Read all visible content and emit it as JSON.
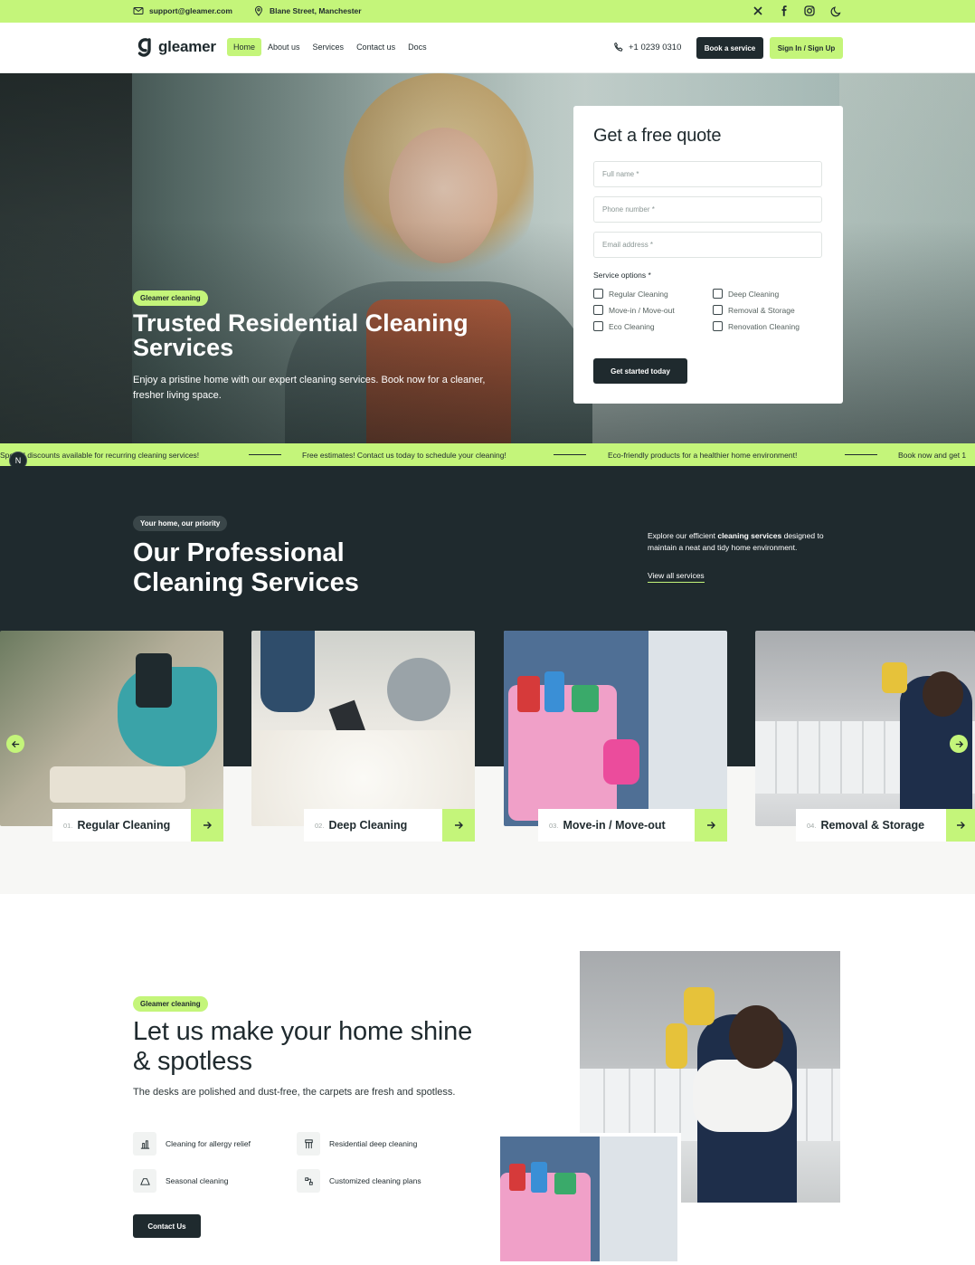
{
  "topbar": {
    "email": "support@gleamer.com",
    "address": "Blane Street, Manchester"
  },
  "nav": {
    "brand": "gleamer",
    "links": [
      "Home",
      "About us",
      "Services",
      "Contact us",
      "Docs"
    ],
    "active": "Home",
    "phone": "+1 0239 0310",
    "book_label": "Book a service",
    "signin_label": "Sign In / Sign Up"
  },
  "hero": {
    "tag": "Gleamer cleaning",
    "title": "Trusted Residential Cleaning Services",
    "subtitle": "Enjoy a pristine home with our expert cleaning services. Book now for a cleaner, fresher living space."
  },
  "quote": {
    "title": "Get a free quote",
    "name_placeholder": "Full name *",
    "phone_placeholder": "Phone number *",
    "email_placeholder": "Email address *",
    "options_label": "Service options *",
    "options": [
      "Regular Cleaning",
      "Deep Cleaning",
      "Move-in / Move-out",
      "Removal & Storage",
      "Eco Cleaning",
      "Renovation Cleaning"
    ],
    "submit_label": "Get started today"
  },
  "ticker": {
    "items": [
      "Special discounts available for recurring cleaning services!",
      "Free estimates! Contact us today to schedule your cleaning!",
      "Eco-friendly products for a healthier home environment!",
      "Book now and get 1"
    ],
    "badge": "N"
  },
  "services": {
    "tag": "Your home, our priority",
    "title": "Our Professional Cleaning Services",
    "lead_prefix": "Explore our efficient ",
    "lead_bold": "cleaning services",
    "lead_suffix": " designed to maintain a neat and tidy home environment.",
    "view_all": "View all services",
    "cards": [
      {
        "num": "01.",
        "name": "Regular Cleaning"
      },
      {
        "num": "02.",
        "name": "Deep Cleaning"
      },
      {
        "num": "03.",
        "name": "Move-in / Move-out"
      },
      {
        "num": "04.",
        "name": "Removal & Storage"
      }
    ]
  },
  "about": {
    "tag": "Gleamer cleaning",
    "title": "Let us make your home shine & spotless",
    "text": "The desks are polished and dust-free, the carpets are fresh and spotless.",
    "features": [
      "Cleaning for allergy relief",
      "Residential deep cleaning",
      "Seasonal cleaning",
      "Customized cleaning plans"
    ],
    "contact_label": "Contact Us"
  },
  "colors": {
    "accent": "#c4f57a",
    "dark": "#1f2a2e"
  }
}
